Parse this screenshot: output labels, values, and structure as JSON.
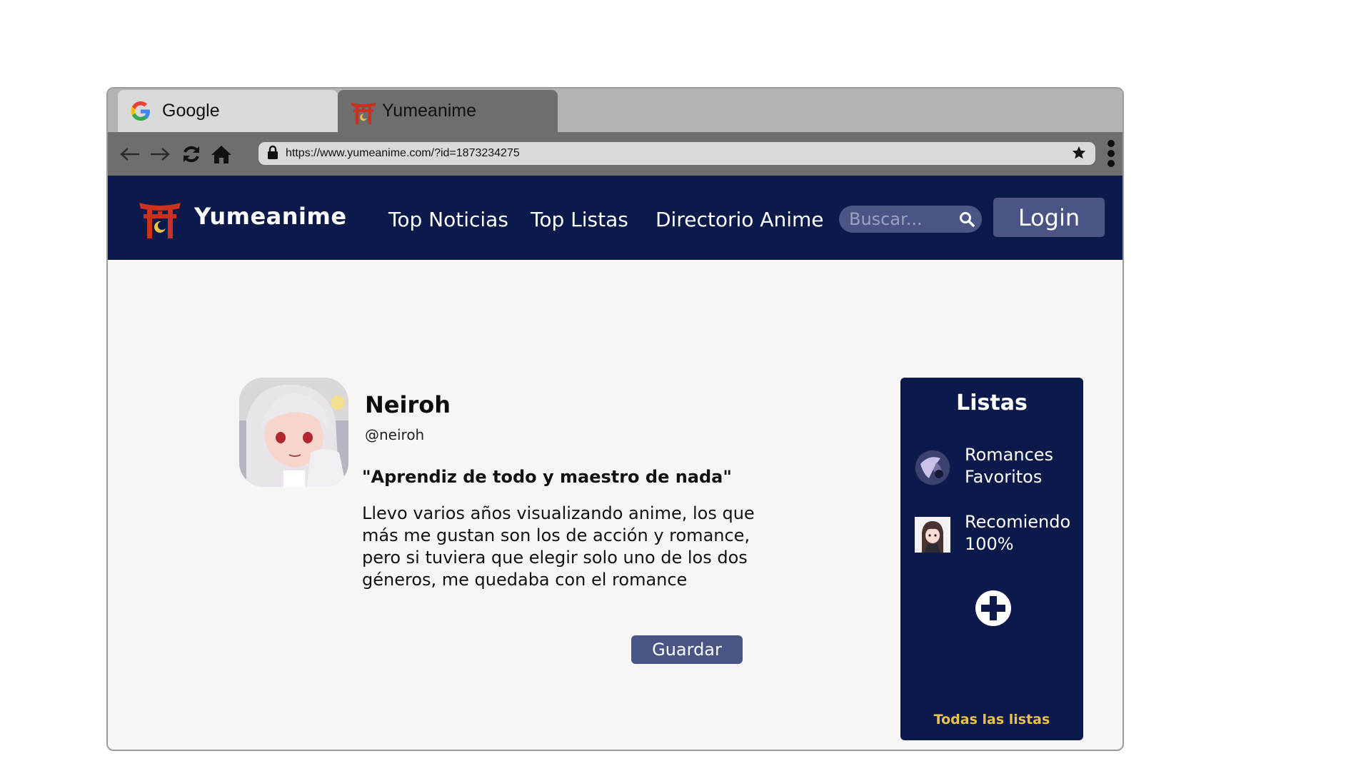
{
  "browser": {
    "tabs": [
      {
        "label": "Google",
        "icon": "google-icon"
      },
      {
        "label": "Yumeanime",
        "icon": "torii-icon"
      }
    ],
    "url": "https://www.yumeanime.com/?id=1873234275"
  },
  "header": {
    "brand": "Yumeanime",
    "nav": [
      "Top Noticias",
      "Top Listas",
      "Directorio Anime"
    ],
    "search_placeholder": "Buscar...",
    "login_label": "Login"
  },
  "profile": {
    "name": "Neiroh",
    "handle": "@neiroh",
    "quote": "\"Aprendiz de todo y maestro de nada\"",
    "bio": "Llevo varios años visualizando anime, los que más me gustan son los de acción y romance, pero si tuviera que elegir solo uno de los dos géneros, me quedaba con el romance",
    "save_label": "Guardar"
  },
  "lists": {
    "title": "Listas",
    "items": [
      {
        "label": "Romances Favoritos"
      },
      {
        "label": "Recomiendo 100%"
      }
    ],
    "all_label": "Todas las listas"
  },
  "colors": {
    "navy": "#0b1a4a",
    "button": "#4a5585",
    "accent_gold": "#e8c24a",
    "torii_red": "#c8321e"
  }
}
